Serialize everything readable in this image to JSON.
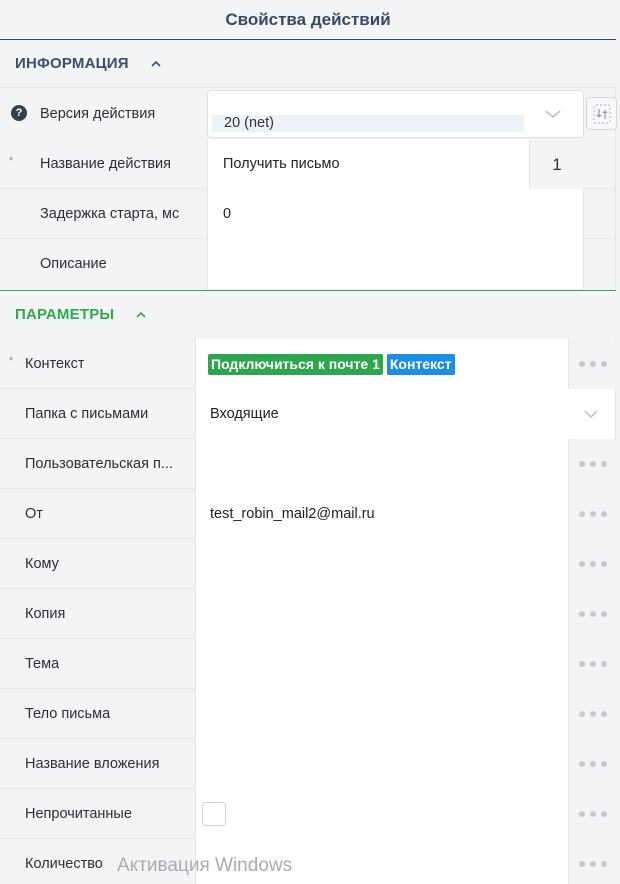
{
  "panel": {
    "title": "Свойства действий"
  },
  "info": {
    "header": "ИНФОРМАЦИЯ",
    "version": {
      "label": "Версия действия",
      "value": "20 (net)"
    },
    "name": {
      "label": "Название действия",
      "value": "Получить письмо",
      "counter": "1"
    },
    "delay": {
      "label": "Задержка старта, мс",
      "value": "0"
    },
    "description": {
      "label": "Описание",
      "value": ""
    }
  },
  "params": {
    "header": "ПАРАМЕТРЫ",
    "context": {
      "label": "Контекст",
      "chip_primary": "Подключиться к почте 1",
      "chip_secondary": "Контекст"
    },
    "folder": {
      "label": "Папка с письмами",
      "value": "Входящие"
    },
    "custom_folder": {
      "label": "Пользовательская п...",
      "value": ""
    },
    "from": {
      "label": "От",
      "value": "test_robin_mail2@mail.ru"
    },
    "to": {
      "label": "Кому",
      "value": ""
    },
    "cc": {
      "label": "Копия",
      "value": ""
    },
    "subject": {
      "label": "Тема",
      "value": ""
    },
    "body": {
      "label": "Тело письма",
      "value": ""
    },
    "attachment": {
      "label": "Название вложения",
      "value": ""
    },
    "unread": {
      "label": "Непрочитанные",
      "checked": false
    },
    "count": {
      "label": "Количество",
      "value": ""
    }
  },
  "watermark": {
    "title": "Активация Windows"
  },
  "colors": {
    "accent_green": "#2fa84f",
    "chip_blue": "#1d8fe3",
    "header_navy": "#37506f"
  }
}
